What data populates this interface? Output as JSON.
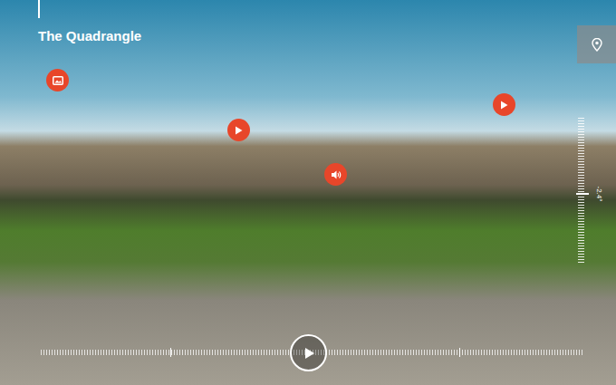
{
  "tour": {
    "title": "The Quadrangle"
  },
  "hotspots": [
    {
      "kind": "gallery"
    },
    {
      "kind": "video"
    },
    {
      "kind": "audio"
    },
    {
      "kind": "video"
    }
  ],
  "zoom": {
    "level": 0.48,
    "reading": "-2.4°"
  },
  "timeline": {
    "level": 0,
    "playing": false
  }
}
